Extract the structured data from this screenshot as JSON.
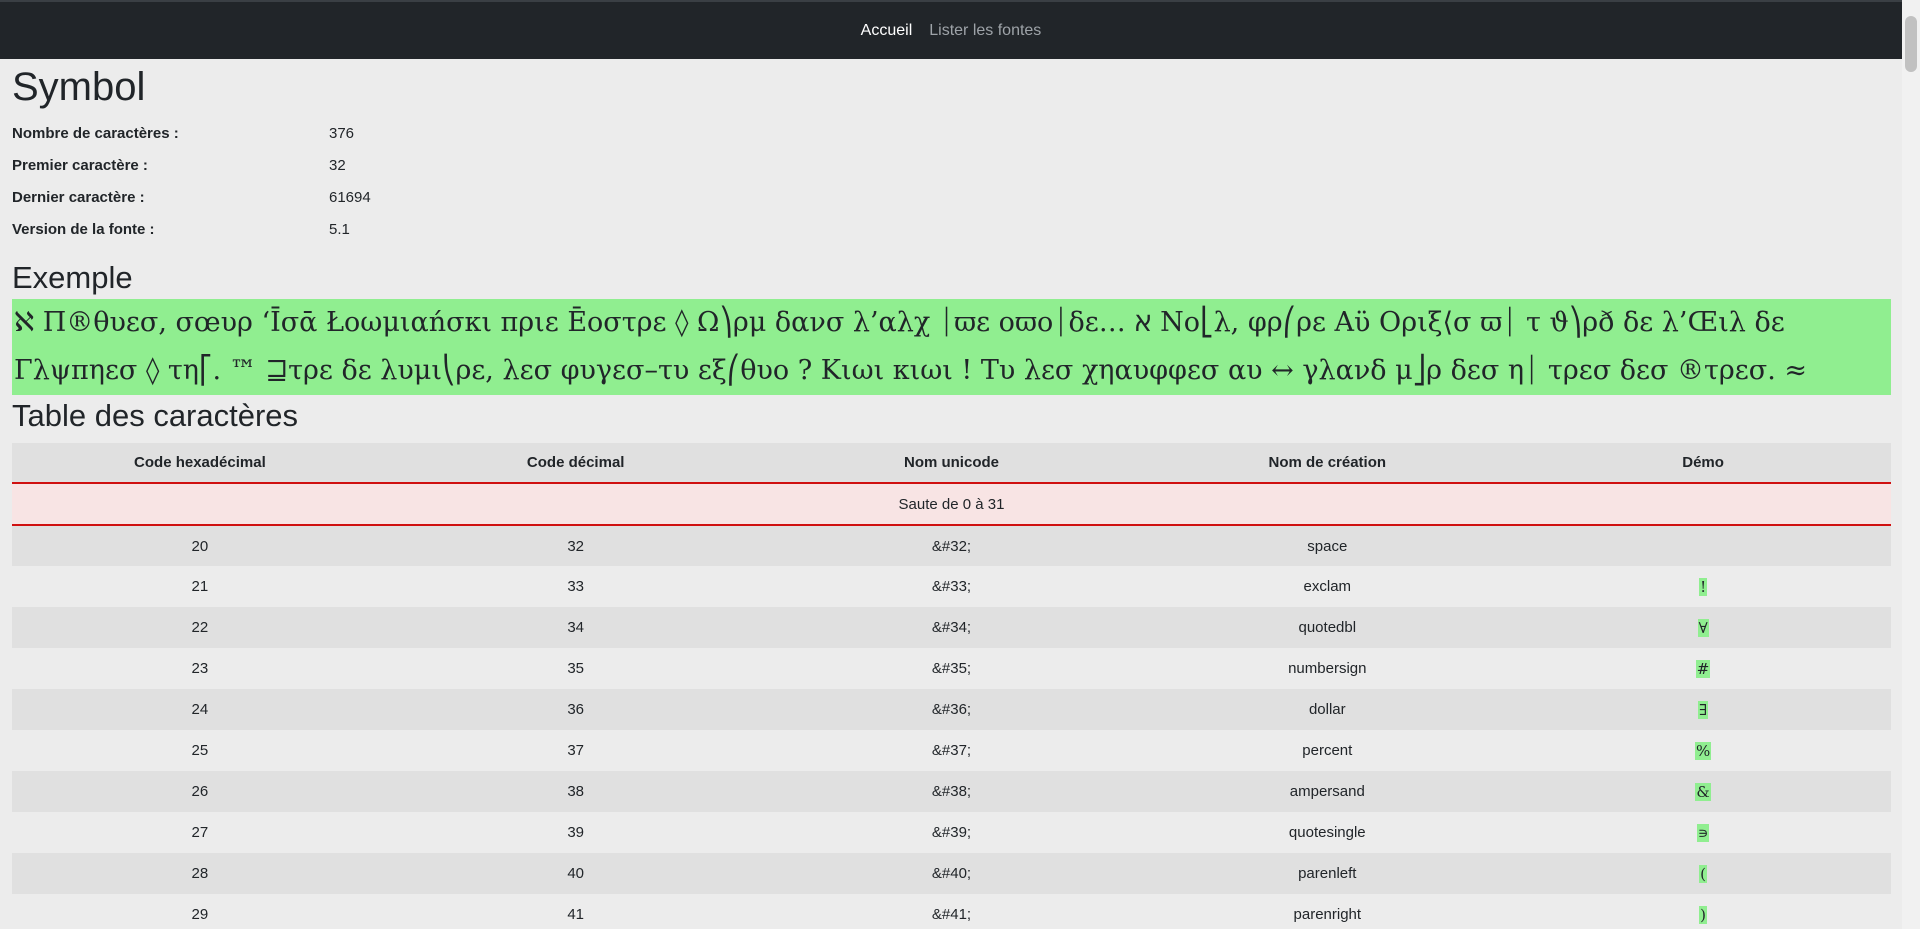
{
  "nav": {
    "home": "Accueil",
    "list_fonts": "Lister les fontes"
  },
  "font": {
    "name": "Symbol",
    "info": [
      {
        "label": "Nombre de caractères :",
        "value": "376"
      },
      {
        "label": "Premier caractère :",
        "value": "32"
      },
      {
        "label": "Dernier caractère :",
        "value": "61694"
      },
      {
        "label": "Version de la fonte :",
        "value": "5.1"
      }
    ]
  },
  "example": {
    "title": "Exemple",
    "text": "ℵ Π®θυεσ, σœυρ ‘Ῑσᾱ Łοωμιαńσκι πριε Ēοστρε ◊ Ω⎞ρμ δανσ λ’αλχ ⏐ϖε οϖο⏐δε… ℵ Νο⎣λ, φρ⎛ρε Αϋ Οριξ⟨σ ϖ⏐ τ ϑ⎞ρð δε λ’Œιλ δε Γλψπηεσ ◊ τη⎡. ™ ⊒τρε δε λυμι⎝ρε, λεσ φυγεσ–τυ εξ⎛θυο ? Κιωι κιωι  ! Τυ λεσ χηαυφφεσ αυ ↔ γλανδ μ⎦ρ δεσ η⏐ τρεσ δεσ ®τρεσ. ≈"
  },
  "table": {
    "title": "Table des caractères",
    "headers": [
      "Code hexadécimal",
      "Code décimal",
      "Nom unicode",
      "Nom de création",
      "Démo"
    ],
    "skip_text": "Saute de 0 à 31",
    "rows": [
      [
        "20",
        "32",
        "&#32;",
        "space",
        ""
      ],
      [
        "21",
        "33",
        "&#33;",
        "exclam",
        "!"
      ],
      [
        "22",
        "34",
        "&#34;",
        "quotedbl",
        "∀"
      ],
      [
        "23",
        "35",
        "&#35;",
        "numbersign",
        "#"
      ],
      [
        "24",
        "36",
        "&#36;",
        "dollar",
        "∃"
      ],
      [
        "25",
        "37",
        "&#37;",
        "percent",
        "%"
      ],
      [
        "26",
        "38",
        "&#38;",
        "ampersand",
        "&"
      ],
      [
        "27",
        "39",
        "&#39;",
        "quotesingle",
        "∍"
      ],
      [
        "28",
        "40",
        "&#40;",
        "parenleft",
        "("
      ],
      [
        "29",
        "41",
        "&#41;",
        "parenright",
        ")"
      ]
    ]
  }
}
